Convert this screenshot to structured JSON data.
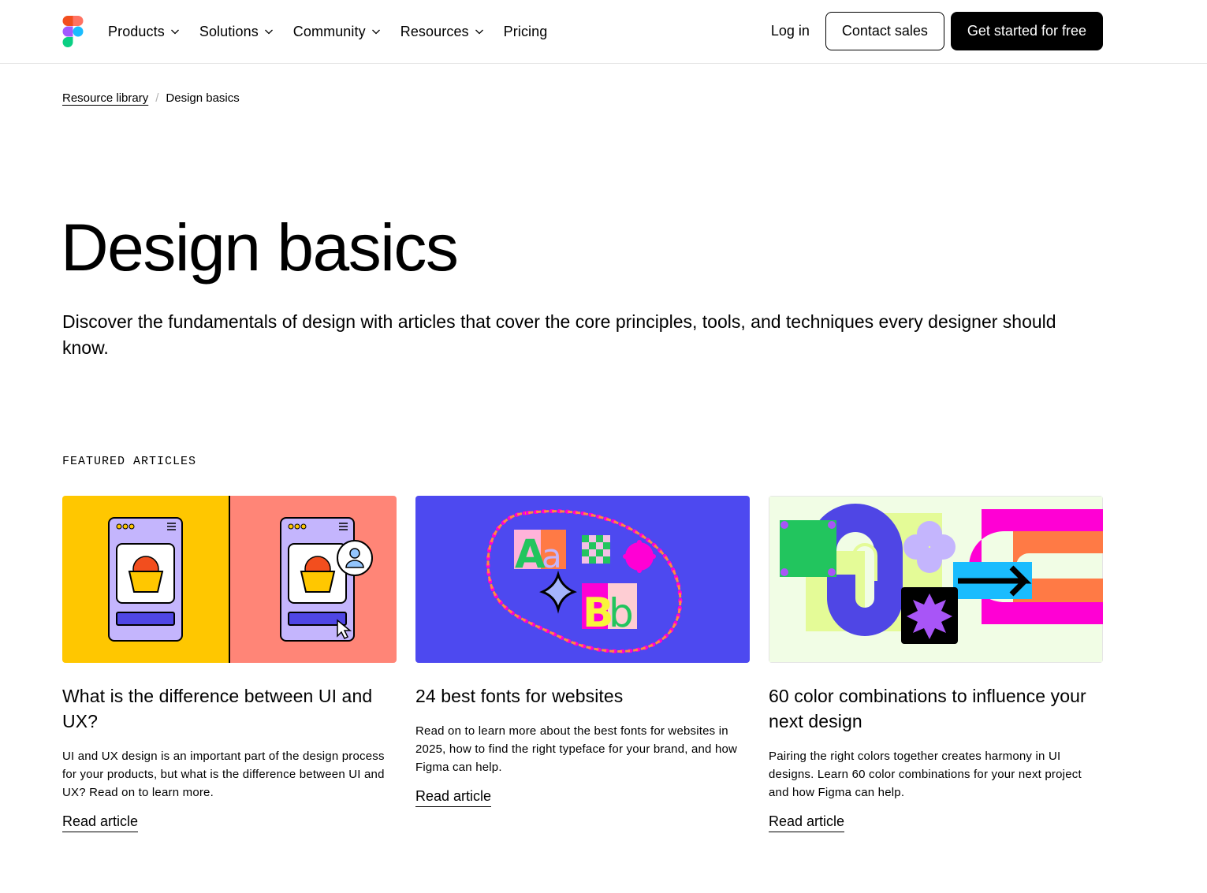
{
  "nav": {
    "items": [
      {
        "label": "Products",
        "has_dropdown": true
      },
      {
        "label": "Solutions",
        "has_dropdown": true
      },
      {
        "label": "Community",
        "has_dropdown": true
      },
      {
        "label": "Resources",
        "has_dropdown": true
      },
      {
        "label": "Pricing",
        "has_dropdown": false
      }
    ],
    "login": "Log in",
    "contact": "Contact sales",
    "cta": "Get started for free"
  },
  "breadcrumb": {
    "parent": "Resource library",
    "separator": "/",
    "current": "Design basics"
  },
  "hero": {
    "title": "Design basics",
    "description": "Discover the fundamentals of design with articles that cover the core principles, tools, and techniques every designer should know."
  },
  "featured": {
    "label": "FEATURED ARTICLES",
    "articles": [
      {
        "title": "What is the difference between UI and UX?",
        "excerpt": "UI and UX design is an important part of the design process for your products, but what is the difference between UI and UX? Read on to learn more.",
        "link": "Read article"
      },
      {
        "title": "24 best fonts for websites",
        "excerpt": "Read on to learn more about the best fonts for websites in 2025, how to find the right typeface for your brand, and how Figma can help.",
        "link": "Read article"
      },
      {
        "title": "60 color combinations to influence your next design",
        "excerpt": "Pairing the right colors together creates harmony in UI designs. Learn 60 color combinations for your next project and how Figma can help.",
        "link": "Read article"
      }
    ]
  },
  "illustration_text": {
    "aa_upper": "A",
    "aa_lower": "a",
    "bb_upper": "B",
    "bb_lower": "b"
  }
}
